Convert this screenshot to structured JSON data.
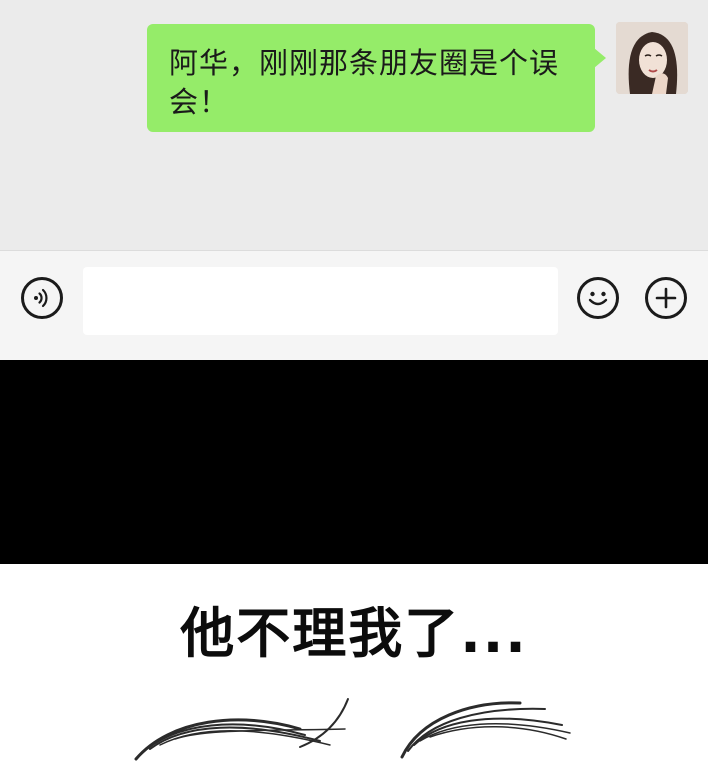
{
  "chat": {
    "message_text": "阿华，刚刚那条朋友圈是个误会！",
    "colors": {
      "background": "#ebebeb",
      "bubble": "#95ec69"
    }
  },
  "input_bar": {
    "voice_icon": "voice-icon",
    "emoji_icon": "emoji-smile-icon",
    "plus_icon": "plus-icon",
    "input_value": ""
  },
  "comic": {
    "caption": "他不理我了..."
  }
}
